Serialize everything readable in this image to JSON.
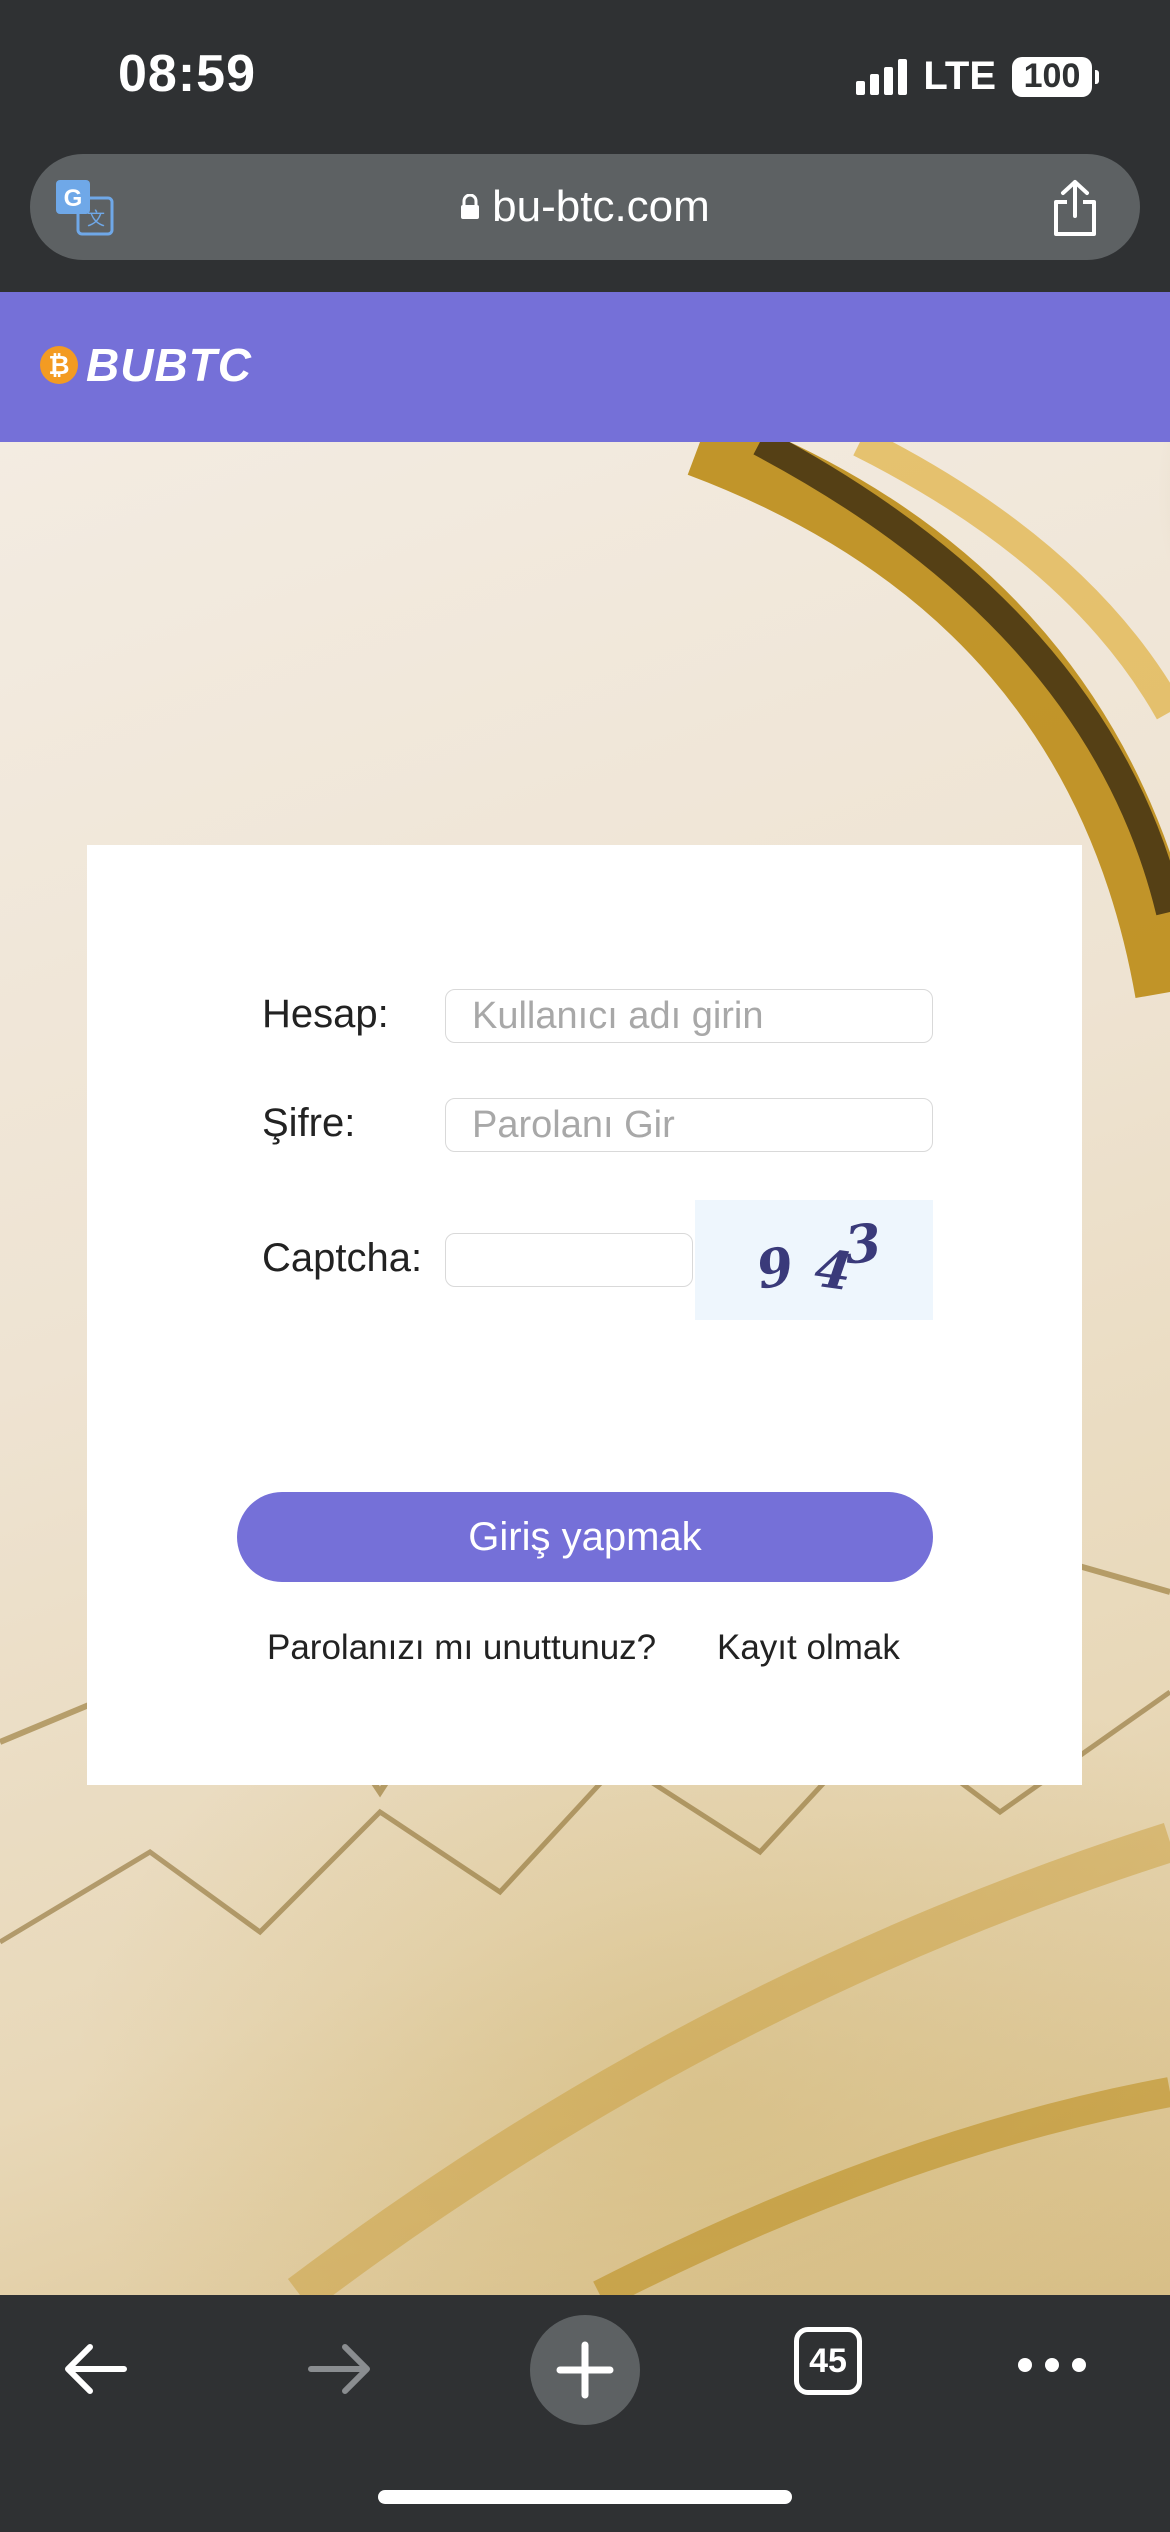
{
  "status_bar": {
    "time": "08:59",
    "network": "LTE",
    "battery": "100"
  },
  "browser": {
    "url": "bu-btc.com",
    "tab_count": "45"
  },
  "site": {
    "logo_text": "BUBTC",
    "logo_coin_symbol": "₿",
    "brand_color": "#7570d8"
  },
  "login": {
    "account_label": "Hesap:",
    "account_placeholder": "Kullanıcı adı girin",
    "password_label": "Şifre:",
    "password_placeholder": "Parolanı Gir",
    "captcha_label": "Captcha:",
    "captcha_value": "",
    "captcha_digits": [
      "9",
      "4",
      "3"
    ],
    "submit_label": "Giriş yapmak",
    "forgot_password_link": "Parolanızı mı unuttunuz?",
    "register_link": "Kayıt olmak"
  },
  "toolbar": {
    "icons": [
      "back-arrow-icon",
      "forward-arrow-icon",
      "plus-icon",
      "tabs-icon",
      "more-icon"
    ]
  }
}
